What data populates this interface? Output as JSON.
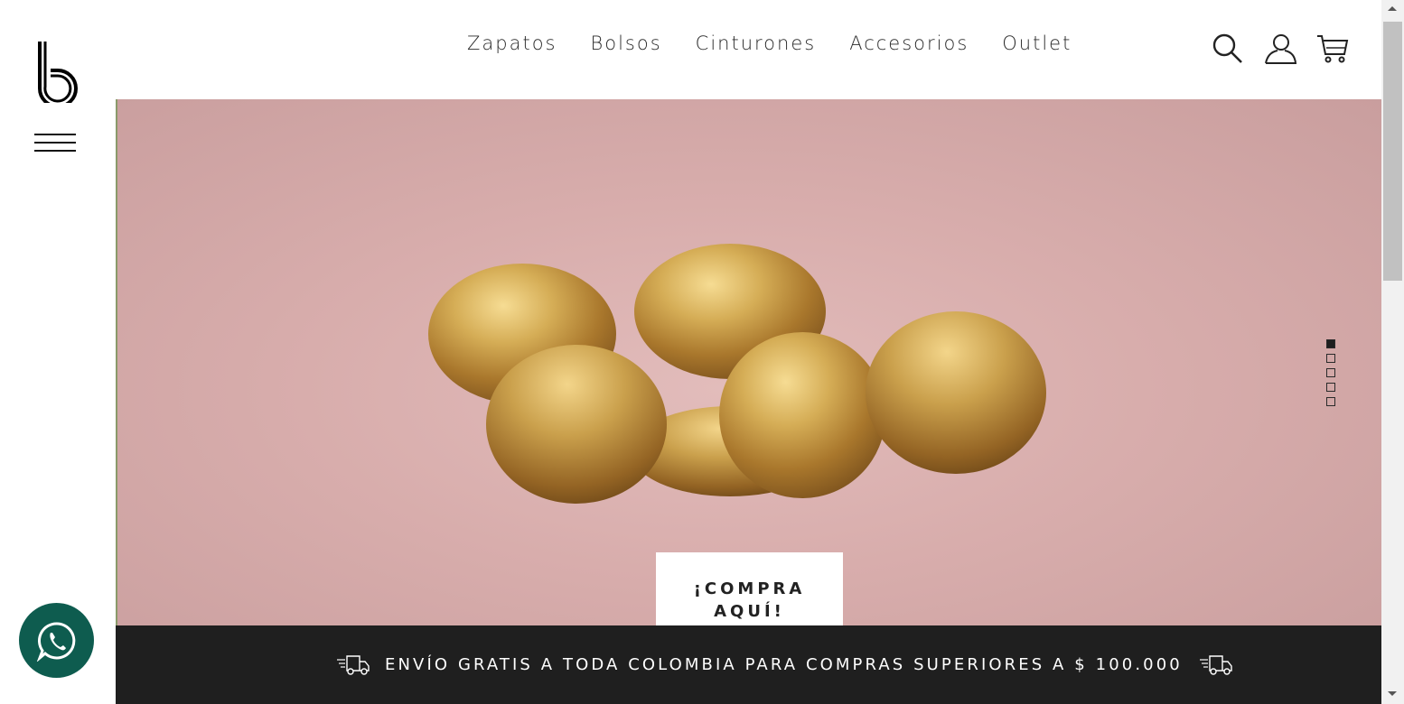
{
  "brand": {
    "logo_icon": "b-logo-icon"
  },
  "nav": {
    "items": [
      {
        "label": "Zapatos"
      },
      {
        "label": "Bolsos"
      },
      {
        "label": "Cinturones"
      },
      {
        "label": "Accesorios"
      },
      {
        "label": "Outlet"
      }
    ]
  },
  "header_icons": [
    "search-icon",
    "user-icon",
    "cart-icon"
  ],
  "hero": {
    "cta_line1": "¡COMPRA",
    "cta_line2": "AQUÍ!",
    "slides_total": 5,
    "active_slide": 1,
    "background_color": "#d8adac"
  },
  "shipping_bar": {
    "text": "ENVÍO GRATIS A TODA COLOMBIA PARA COMPRAS SUPERIORES A $ 100.000",
    "background_color": "#1f1f1f"
  },
  "whatsapp": {
    "icon": "whatsapp-icon",
    "color": "#0e5c4f"
  }
}
